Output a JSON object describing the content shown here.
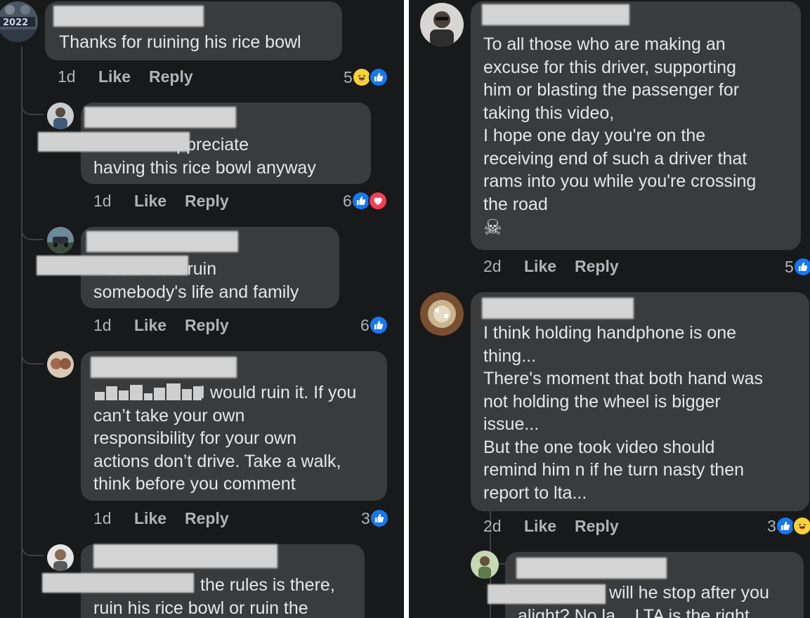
{
  "left": {
    "comments": [
      {
        "text": "Thanks for ruining his rice bowl",
        "time": "1d",
        "like": "Like",
        "reply": "Reply",
        "reaction_count": "5"
      },
      {
        "mention_tail": "n",
        "text": " he dun appreciate\nhaving this rice bowl anyway",
        "time": "1d",
        "like": "Like",
        "reply": "Reply",
        "reaction_count": "6"
      },
      {
        "mention_tail": "n",
        "text": " before he ruin\nsomebody's life and family",
        "time": "1d",
        "like": "Like",
        "reply": "Reply",
        "reaction_count": "6"
      },
      {
        "text": "I would ruin it. If you\ncan’t take your own\nresponsibility for your own\nactions don’t drive. Take a walk,\nthink before you comment",
        "time": "1d",
        "like": "Like",
        "reply": "Reply",
        "reaction_count": "3"
      },
      {
        "text": " the rules is there,\nruin his rice bowl or ruin the"
      }
    ]
  },
  "right": {
    "comments": [
      {
        "text": "To all those who are making an\nexcuse for this driver, supporting\nhim or blasting the passenger for\ntaking this video,\nI hope one day you're on the\nreceiving end of such a driver that\nrams into you while you're crossing\nthe road",
        "emoji": "☠",
        "time": "2d",
        "like": "Like",
        "reply": "Reply",
        "reaction_count": "5"
      },
      {
        "text": "I think holding handphone is one\nthing...\nThere's moment that both hand was\nnot holding the wheel is bigger\nissue...\nBut the one took video should\nremind him n if he turn nasty then\nreport to lta...",
        "time": "2d",
        "like": "Like",
        "reply": "Reply",
        "reaction_count": "3"
      },
      {
        "text": " will he stop after you\nalight? No la... LTA is the right"
      }
    ]
  },
  "icons": {
    "like": "thumbs-up-icon",
    "love": "heart-icon",
    "haha": "laughing-face-icon",
    "skull": "skull-crossbones-icon"
  },
  "colors": {
    "background": "#18191a",
    "bubble": "#3a3b3c",
    "text": "#e4e6eb",
    "meta": "#b0b3b8",
    "like_blue": "#1877f2",
    "love_red": "#f33e58",
    "haha_yellow": "#f7d13a",
    "mention_blue": "#4599ff"
  }
}
